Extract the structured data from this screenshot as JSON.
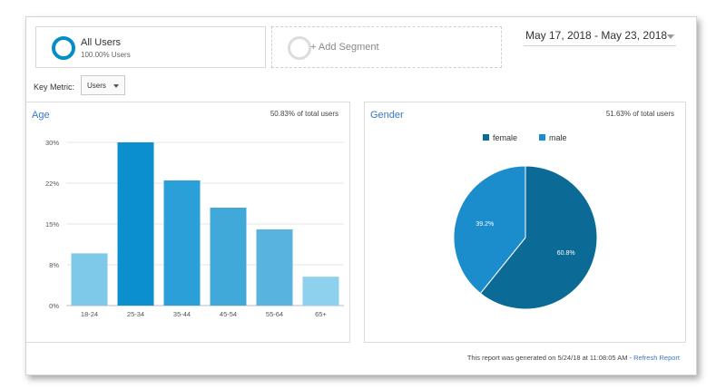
{
  "segments": {
    "all_users": {
      "title": "All Users",
      "subtitle": "100.00% Users",
      "icon": "segment-ring-icon"
    },
    "add_segment": {
      "label": "+ Add Segment"
    }
  },
  "date_range": {
    "label": "May 17, 2018 - May 23, 2018"
  },
  "key_metric": {
    "label": "Key Metric:",
    "value": "Users"
  },
  "age_panel": {
    "title": "Age",
    "share": "50.83% of total users"
  },
  "gender_panel": {
    "title": "Gender",
    "share": "51.63% of total users"
  },
  "footer": {
    "text": "This report was generated on 5/24/18 at 11:08:05 AM - ",
    "refresh": "Refresh Report"
  },
  "colors": {
    "accent": "#058dc7",
    "link": "#3a78c4",
    "female": "#0b6a96",
    "male": "#1b8ccc"
  },
  "chart_data": [
    {
      "type": "bar",
      "title": "Age",
      "categories": [
        "18-24",
        "25-34",
        "35-44",
        "45-54",
        "55-64",
        "65+"
      ],
      "values": [
        9.6,
        30,
        23,
        18,
        14,
        5.3
      ],
      "yticks": [
        "0%",
        "8%",
        "15%",
        "22%",
        "30%"
      ],
      "ylim": [
        0,
        30
      ],
      "grid": true,
      "colors": [
        "#7ec8e9",
        "#0c8fcf",
        "#2b9fd7",
        "#41a8da",
        "#58b3df",
        "#8dd1ef"
      ]
    },
    {
      "type": "pie",
      "title": "Gender",
      "labels": [
        "female",
        "male"
      ],
      "values": [
        60.8,
        39.2
      ],
      "value_labels": [
        "60.8%",
        "39.2%"
      ],
      "colors": [
        "#0b6a96",
        "#1b8ccc"
      ],
      "legend": "top"
    }
  ]
}
